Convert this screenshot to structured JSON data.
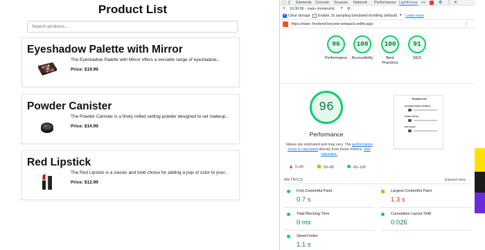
{
  "app": {
    "title": "Product List",
    "search_placeholder": "Search products...",
    "products": [
      {
        "name": "Eyeshadow Palette with Mirror",
        "description": "The Eyeshadow Palette with Mirror offers a versatile range of eyeshadow...",
        "price_label": "Price:",
        "price": "$19.99",
        "thumb_icon": "eyeshadow-palette-icon"
      },
      {
        "name": "Powder Canister",
        "description": "The Powder Canister is a finely milled setting powder designed to set makeup...",
        "price_label": "Price:",
        "price": "$14.99",
        "thumb_icon": "powder-compact-icon"
      },
      {
        "name": "Red Lipstick",
        "description": "The Red Lipstick is a classic and bold choice for adding a pop of color to your...",
        "price_label": "Price:",
        "price": "$12.99",
        "thumb_icon": "lipstick-icon"
      }
    ]
  },
  "devtools": {
    "tabs": [
      "Elements",
      "Console",
      "Sources",
      "Network",
      "Performance",
      "Lighthouse",
      ">>"
    ],
    "active_tab": "Lighthouse",
    "toolbar": {
      "report_label": "16:30:06 - main--frontend-E"
    },
    "options": {
      "clear_storage": "Clear storage",
      "js_sampling": "Enable JS sampling",
      "throttling": "Simulated throttling (default)",
      "learn_more": "Learn more"
    },
    "url": "https://main--frontend-beyond-webpack.netlify.app/",
    "gauges": [
      {
        "score": "96",
        "label": "Performance"
      },
      {
        "score": "100",
        "label": "Accessibility"
      },
      {
        "score": "100",
        "label": "Best Practices"
      },
      {
        "score": "91",
        "label": "SEO"
      }
    ],
    "performance": {
      "score": "96",
      "label": "Performance",
      "note_1": "Values are estimated and may vary. The ",
      "note_link_1": "performance score is calculated",
      "note_2": " directly from these metrics. ",
      "note_link_2": "See calculator.",
      "legend": [
        "0–49",
        "50–89",
        "90–100"
      ]
    },
    "thumbnail": {
      "title": "Product List",
      "items": [
        "Eyeshadow Palette with Mirror",
        "Powder Canister",
        "Red Lipstick"
      ]
    },
    "metrics": {
      "heading": "METRICS",
      "expand": "Expand view",
      "items": [
        {
          "name": "First Contentful Paint",
          "value": "0.7 s",
          "status": "green"
        },
        {
          "name": "Largest Contentful Paint",
          "value": "1.3 s",
          "status": "orange"
        },
        {
          "name": "Total Blocking Time",
          "value": "0 ms",
          "status": "green"
        },
        {
          "name": "Cumulative Layout Shift",
          "value": "0.026",
          "status": "green"
        },
        {
          "name": "Speed Index",
          "value": "1.1 s",
          "status": "green"
        }
      ]
    },
    "colors": {
      "pass": "#0cce6b",
      "average": "#ffa400",
      "fail": "#e53935",
      "link": "#1a73e8"
    }
  }
}
